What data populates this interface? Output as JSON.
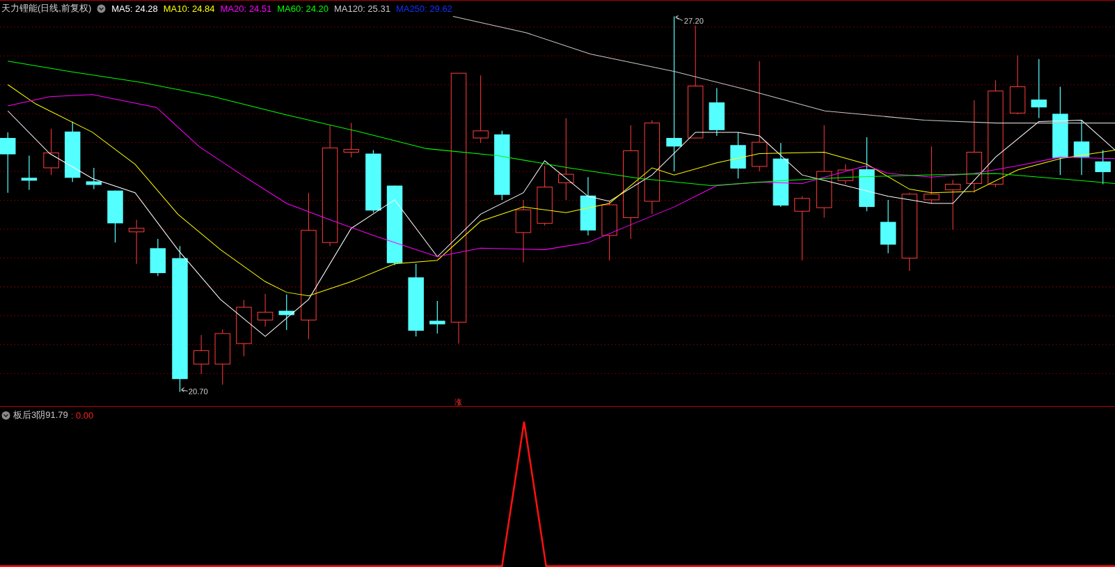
{
  "header": {
    "title": "天力锂能(日线,前复权)",
    "moving_averages": [
      {
        "label": "MA5: 24.28",
        "color": "#ffffff"
      },
      {
        "label": "MA10: 24.84",
        "color": "#ffff00"
      },
      {
        "label": "MA20: 24.51",
        "color": "#ff00ff"
      },
      {
        "label": "MA60: 24.20",
        "color": "#00ff00"
      },
      {
        "label": "MA120: 25.31",
        "color": "#c8c8c8"
      },
      {
        "label": "MA250: 29.62",
        "color": "#1030ff"
      }
    ]
  },
  "price_chart": {
    "high_label": "27.20",
    "low_label": "20.70",
    "limit_up_marker": "涨"
  },
  "indicator": {
    "name": "板后3阴91.79",
    "value": ": 0.00"
  }
}
